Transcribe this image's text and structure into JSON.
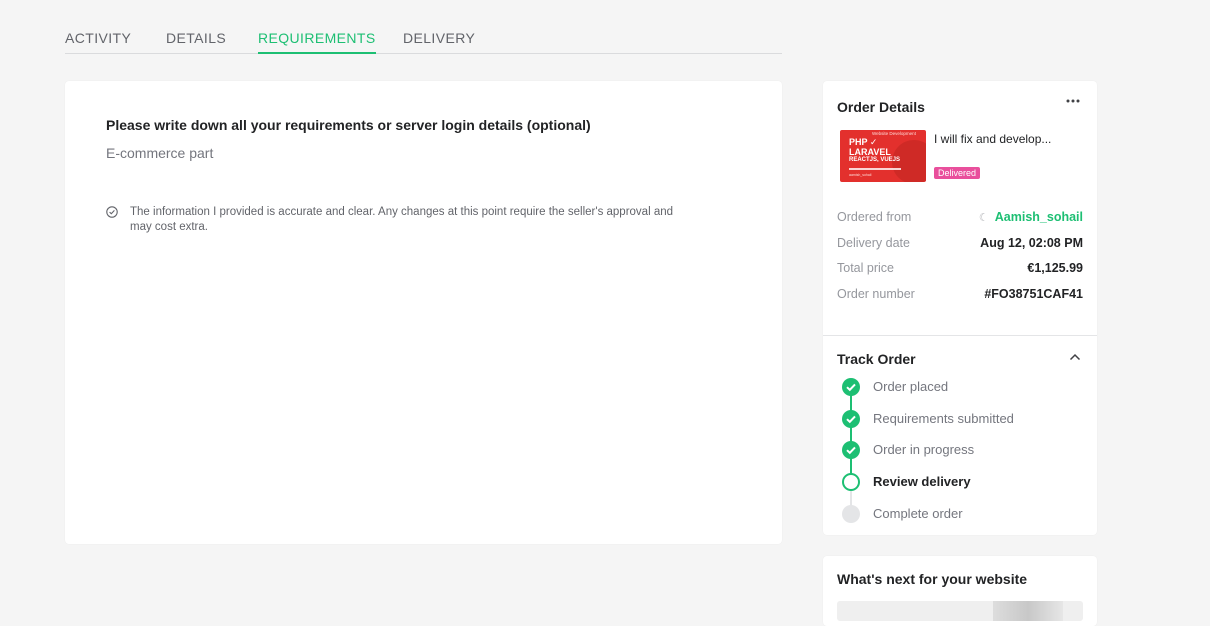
{
  "tabs": [
    {
      "label": "ACTIVITY"
    },
    {
      "label": "DETAILS"
    },
    {
      "label": "REQUIREMENTS",
      "active": true
    },
    {
      "label": "DELIVERY"
    }
  ],
  "requirements": {
    "question": "Please write down all your requirements or server login details (optional)",
    "answer": "E-commerce part",
    "acknowledgement": "The information I provided is accurate and clear. Any changes at this point require the seller's approval and may cost extra."
  },
  "order_details": {
    "title": "Order Details",
    "more_icon": "more-horizontal-icon",
    "gig": {
      "title": "I will fix and develop...",
      "status": "Delivered",
      "thumbnail_text": {
        "category": "Website Development",
        "line1": "PHP ✓",
        "line2": "LARAVEL",
        "line3": "REACTJS, VUEJS",
        "footer": "aamish_sohail"
      }
    },
    "rows": [
      {
        "label": "Ordered from",
        "value": "Aamish_sohail"
      },
      {
        "label": "Delivery date",
        "value": "Aug 12, 02:08 PM"
      },
      {
        "label": "Total price",
        "value": "€1,125.99"
      },
      {
        "label": "Order number",
        "value": "#FO38751CAF41"
      }
    ]
  },
  "track_order": {
    "title": "Track Order",
    "collapse_icon": "chevron-up-icon",
    "steps": [
      {
        "label": "Order placed",
        "status": "done"
      },
      {
        "label": "Requirements submitted",
        "status": "done"
      },
      {
        "label": "Order in progress",
        "status": "done"
      },
      {
        "label": "Review delivery",
        "status": "current"
      },
      {
        "label": "Complete order",
        "status": "todo"
      }
    ]
  },
  "next": {
    "title": "What's next for your website"
  },
  "colors": {
    "accent": "#1dbf73",
    "delivered_badge": "#e94f9c",
    "thumbnail": "#e3302d"
  }
}
